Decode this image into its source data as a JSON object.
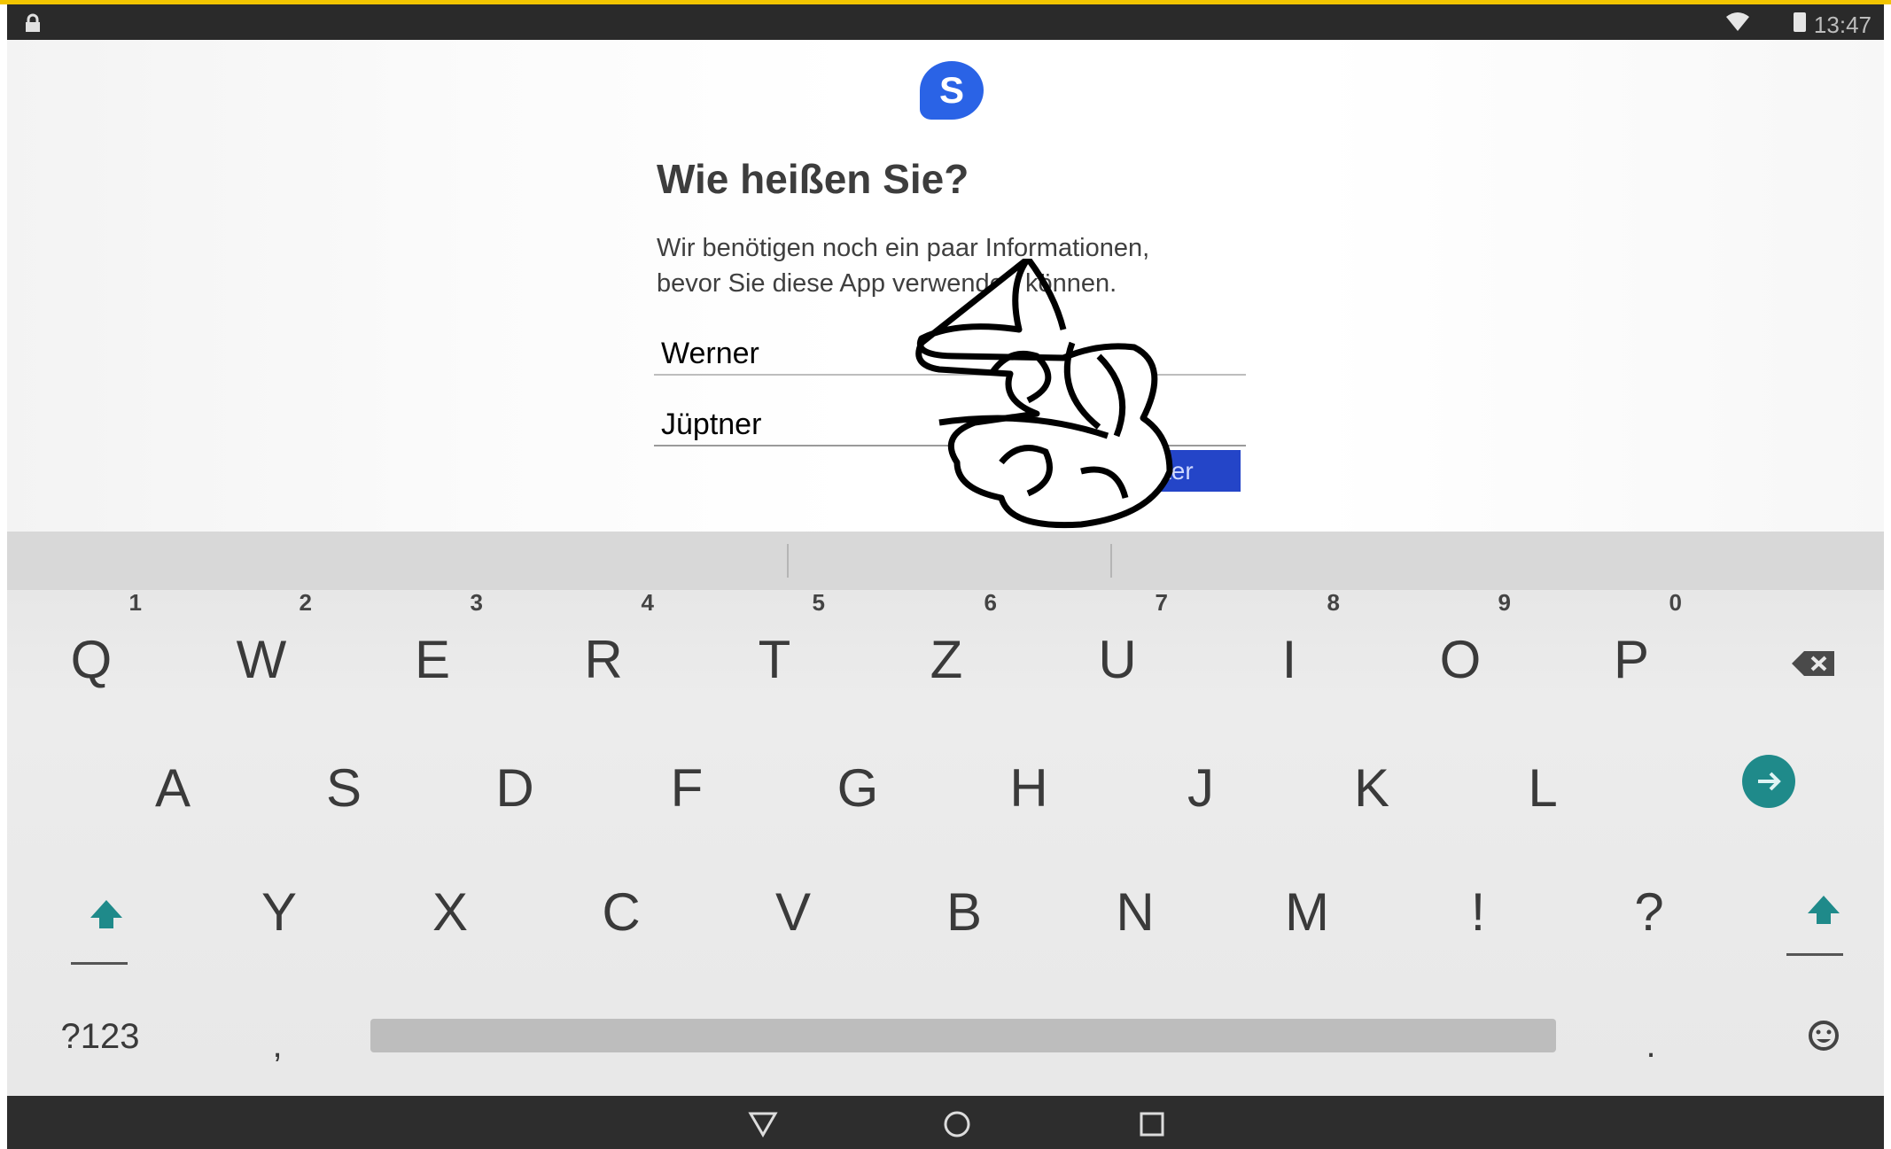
{
  "status_bar": {
    "time": "13:47",
    "icons": [
      "lock-icon",
      "wifi-icon",
      "battery-icon"
    ]
  },
  "app": {
    "logo_letter": "S",
    "title": "Wie heißen Sie?",
    "subtitle_line1": "Wir benötigen noch ein paar Informationen,",
    "subtitle_line2": "bevor Sie diese App verwenden können.",
    "first_name_value": "Werner",
    "last_name_value": "Jüptner",
    "next_button_label": "ter",
    "colors": {
      "logo": "#2a63e6",
      "button": "#2445c8",
      "enter_key": "#1f8a8a"
    }
  },
  "keyboard": {
    "row1": [
      "Q",
      "W",
      "E",
      "R",
      "T",
      "Z",
      "U",
      "I",
      "O",
      "P"
    ],
    "row1_hints": [
      "1",
      "2",
      "3",
      "4",
      "5",
      "6",
      "7",
      "8",
      "9",
      "0"
    ],
    "row2": [
      "A",
      "S",
      "D",
      "F",
      "G",
      "H",
      "J",
      "K",
      "L"
    ],
    "row3": [
      "Y",
      "X",
      "C",
      "V",
      "B",
      "N",
      "M",
      "!",
      "?"
    ],
    "symbols_key": "?123",
    "comma_key": ",",
    "period_key": ".",
    "icons": [
      "backspace-icon",
      "enter-arrow-icon",
      "shift-icon",
      "emoji-icon"
    ]
  },
  "nav_bar": {
    "icons": [
      "back-icon",
      "home-icon",
      "recents-icon"
    ]
  }
}
